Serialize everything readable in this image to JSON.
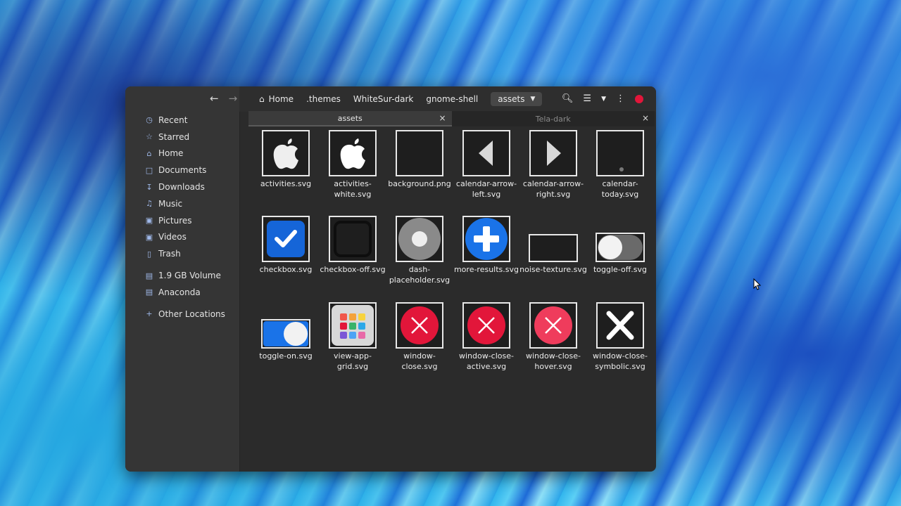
{
  "nav": {
    "back_icon": "arrow-left-icon",
    "forward_icon": "arrow-right-icon"
  },
  "sidebar": {
    "items": [
      {
        "label": "Recent",
        "icon": "clock-icon"
      },
      {
        "label": "Starred",
        "icon": "star-icon"
      },
      {
        "label": "Home",
        "icon": "home-icon"
      },
      {
        "label": "Documents",
        "icon": "document-icon"
      },
      {
        "label": "Downloads",
        "icon": "download-icon"
      },
      {
        "label": "Music",
        "icon": "music-icon"
      },
      {
        "label": "Pictures",
        "icon": "picture-icon"
      },
      {
        "label": "Videos",
        "icon": "video-icon"
      },
      {
        "label": "Trash",
        "icon": "trash-icon"
      },
      {
        "label": "1.9 GB Volume",
        "icon": "drive-icon"
      },
      {
        "label": "Anaconda",
        "icon": "drive-icon"
      },
      {
        "label": "Other Locations",
        "icon": "plus-icon"
      }
    ]
  },
  "breadcrumb": [
    "Home",
    ".themes",
    "WhiteSur-dark",
    "gnome-shell",
    "assets"
  ],
  "tabs": [
    {
      "label": "assets",
      "active": true
    },
    {
      "label": "Tela-dark",
      "active": false
    }
  ],
  "files": [
    {
      "name": "activities.svg"
    },
    {
      "name": "activities-white.svg"
    },
    {
      "name": "background.png"
    },
    {
      "name": "calendar-arrow-left.svg"
    },
    {
      "name": "calendar-arrow-right.svg"
    },
    {
      "name": "calendar-today.svg"
    },
    {
      "name": "checkbox.svg"
    },
    {
      "name": "checkbox-off.svg"
    },
    {
      "name": "dash-placeholder.svg"
    },
    {
      "name": "more-results.svg"
    },
    {
      "name": "noise-texture.svg"
    },
    {
      "name": "toggle-off.svg"
    },
    {
      "name": "toggle-on.svg"
    },
    {
      "name": "view-app-grid.svg"
    },
    {
      "name": "window-close.svg"
    },
    {
      "name": "window-close-active.svg"
    },
    {
      "name": "window-close-hover.svg"
    },
    {
      "name": "window-close-symbolic.svg"
    }
  ],
  "colors": {
    "accent": "#1a73e8",
    "close_red": "#e2163a",
    "sidebar_bg": "#353535",
    "content_bg": "#2b2b2b"
  }
}
